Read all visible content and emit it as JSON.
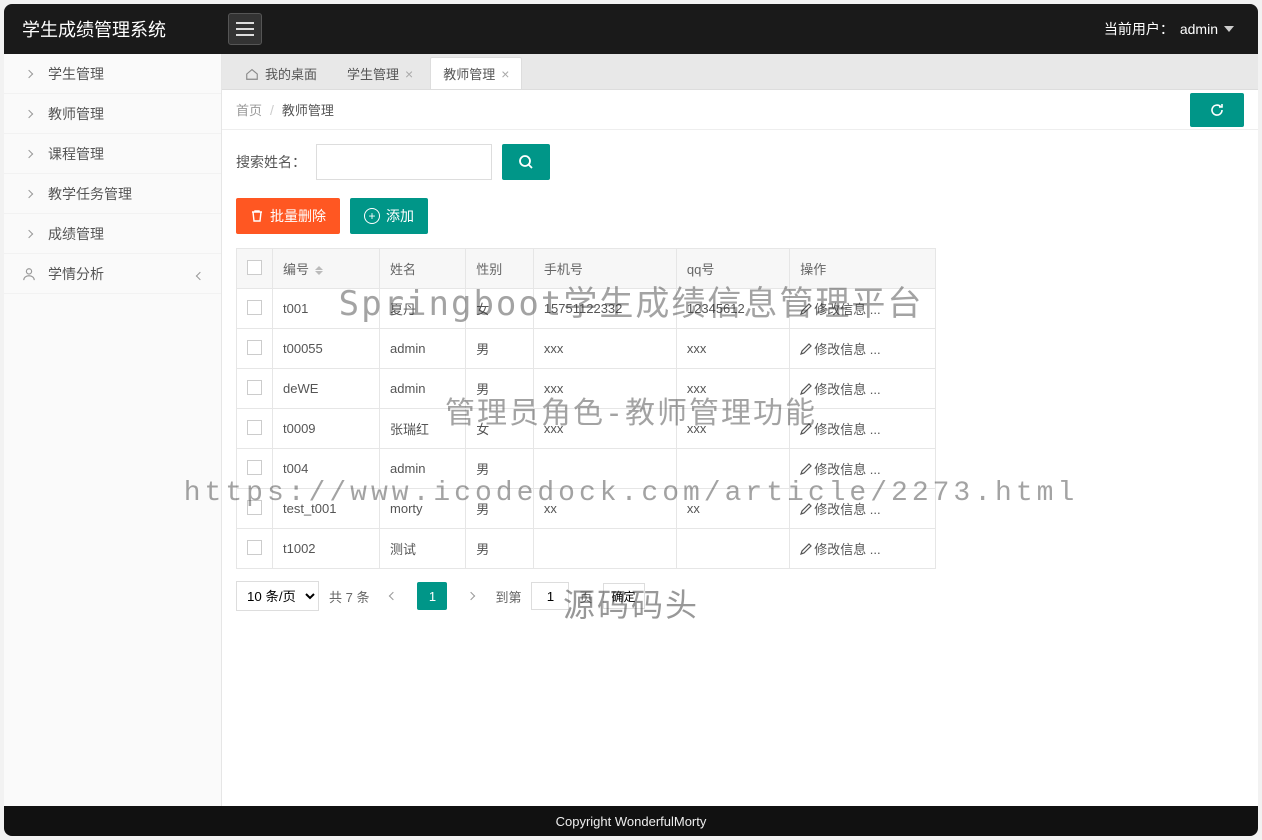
{
  "brand": "学生成绩管理系统",
  "user": {
    "label": "当前用户：",
    "name": "admin"
  },
  "sidebar": {
    "items": [
      {
        "label": "学生管理",
        "icon": "chev"
      },
      {
        "label": "教师管理",
        "icon": "chev"
      },
      {
        "label": "课程管理",
        "icon": "chev"
      },
      {
        "label": "教学任务管理",
        "icon": "chev"
      },
      {
        "label": "成绩管理",
        "icon": "chev"
      },
      {
        "label": "学情分析",
        "icon": "user",
        "tail": "chev-left"
      }
    ]
  },
  "tabs": [
    {
      "label": "我的桌面",
      "home": true
    },
    {
      "label": "学生管理",
      "closable": true
    },
    {
      "label": "教师管理",
      "closable": true,
      "active": true
    }
  ],
  "breadcrumb": {
    "root": "首页",
    "current": "教师管理"
  },
  "search": {
    "label": "搜索姓名：",
    "value": ""
  },
  "actions": {
    "bulk_delete": "批量删除",
    "add": "添加"
  },
  "table": {
    "headers": {
      "id": "编号",
      "name": "姓名",
      "gender": "性别",
      "phone": "手机号",
      "qq": "qq号",
      "op": "操作"
    },
    "op_label": "修改信息 ...",
    "rows": [
      {
        "id": "t001",
        "name": "夏丹",
        "gender": "女",
        "phone": "15751122332",
        "qq": "12345612"
      },
      {
        "id": "t00055",
        "name": "admin",
        "gender": "男",
        "phone": "xxx",
        "qq": "xxx"
      },
      {
        "id": "deWE",
        "name": "admin",
        "gender": "男",
        "phone": "xxx",
        "qq": "xxx"
      },
      {
        "id": "t0009",
        "name": "张瑞红",
        "gender": "女",
        "phone": "xxx",
        "qq": "xxx"
      },
      {
        "id": "t004",
        "name": "admin",
        "gender": "男",
        "phone": "",
        "qq": ""
      },
      {
        "id": "test_t001",
        "name": "morty",
        "gender": "男",
        "phone": "xx",
        "qq": "xx"
      },
      {
        "id": "t1002",
        "name": "测试",
        "gender": "男",
        "phone": "",
        "qq": ""
      }
    ]
  },
  "pager": {
    "pagesize": "10 条/页",
    "total": "共 7 条",
    "current": "1",
    "jump_label": "到第",
    "jump_value": "1",
    "jump_unit": "页",
    "confirm": "确定"
  },
  "footer": "Copyright WonderfulMorty",
  "watermarks": {
    "w1": "Springboot学生成绩信息管理平台",
    "w2": "管理员角色-教师管理功能",
    "w3": "https://www.icodedock.com/article/2273.html",
    "w4": "源码码头"
  }
}
